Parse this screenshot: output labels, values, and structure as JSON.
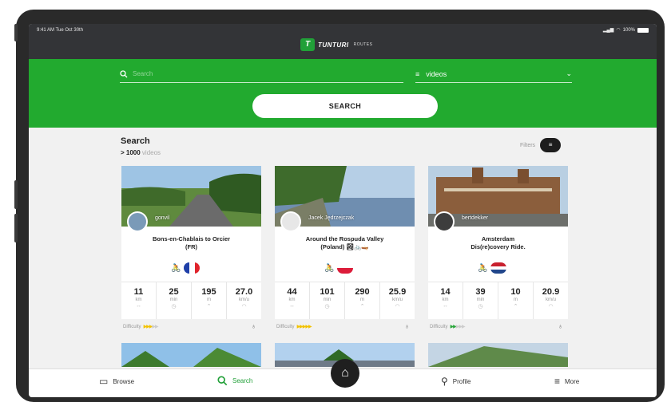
{
  "status": {
    "time": "9:41 AM  Tue Oct 30th",
    "battery": "100%"
  },
  "brand": {
    "logo_text": "TUNTURI",
    "logo_sub": "ROUTES"
  },
  "search": {
    "placeholder": "Search",
    "type_value": "videos",
    "button_label": "SEARCH"
  },
  "results": {
    "title": "Search",
    "count": "> 1000",
    "count_suffix": " videos",
    "filters_label": "Filters"
  },
  "cards": [
    {
      "user": "gonvil",
      "title": "Bons-en-Chablais to Orcier",
      "title2": "(FR)",
      "flag": "france",
      "stats": [
        {
          "v": "11",
          "u": "km"
        },
        {
          "v": "25",
          "u": "min"
        },
        {
          "v": "195",
          "u": "m"
        },
        {
          "v": "27.0",
          "u": "km/u"
        }
      ],
      "difficulty_label": "Difficulty",
      "difficulty_color": "#f2c200",
      "difficulty_level": 3
    },
    {
      "user": "Jacek Jędrzejczak",
      "title": "Around the Rospuda Valley",
      "title2": "(Poland)",
      "flag": "poland",
      "stats": [
        {
          "v": "44",
          "u": "km"
        },
        {
          "v": "101",
          "u": "min"
        },
        {
          "v": "290",
          "u": "m"
        },
        {
          "v": "25.9",
          "u": "km/u"
        }
      ],
      "difficulty_label": "Difficulty",
      "difficulty_color": "#f2c200",
      "difficulty_level": 5
    },
    {
      "user": "bertdekker",
      "title": "Amsterdam",
      "title2": "Dis(re)covery Ride.",
      "flag": "netherlands",
      "stats": [
        {
          "v": "14",
          "u": "km"
        },
        {
          "v": "39",
          "u": "min"
        },
        {
          "v": "10",
          "u": "m"
        },
        {
          "v": "20.9",
          "u": "km/u"
        }
      ],
      "difficulty_label": "Difficulty",
      "difficulty_color": "#29a63a",
      "difficulty_level": 2
    }
  ],
  "tabs": {
    "browse": "Browse",
    "search": "Search",
    "profile": "Profile",
    "more": "More"
  },
  "colors": {
    "accent": "#22aa2f",
    "topbar": "#333437"
  }
}
